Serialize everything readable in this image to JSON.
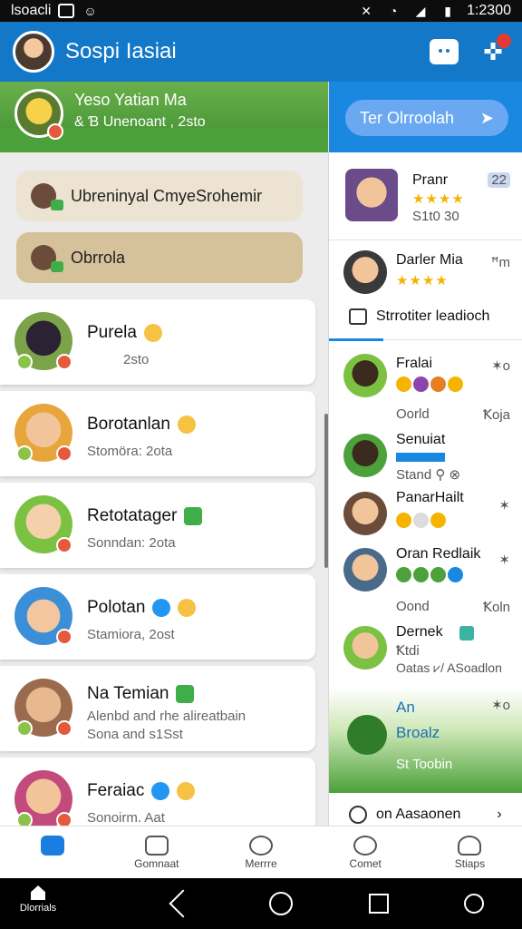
{
  "status_bar": {
    "left_text": "Ɩsoacli",
    "time": "1:2300"
  },
  "app_bar": {
    "title": "Sospi Iasiai"
  },
  "hero": {
    "title": "Yeso Yatian Ma",
    "subtitle": "& Ɓ Unenoant , 2sto"
  },
  "pills": [
    {
      "label": "Ubreninyal CmyeSrohemir"
    },
    {
      "label": "Obrrola"
    }
  ],
  "contacts": [
    {
      "name": "Purela",
      "meta": "2sto",
      "avatar_color": "#4b3a55"
    },
    {
      "name": "Borotanlan",
      "meta": "Stomöra: 2ota",
      "avatar_color": "#e6a63b"
    },
    {
      "name": "Retotatager",
      "meta": "Sonndan: 2ota",
      "avatar_color": "#7cc242"
    },
    {
      "name": "Polotan",
      "meta": "Stamiora, 2ost",
      "avatar_color": "#3b8fd6"
    },
    {
      "name": "Na Temian",
      "meta": "Alenbd and rhe alireatbain\nSona and s1Sst",
      "avatar_color": "#9a6b4e"
    },
    {
      "name": "Feraiac",
      "meta": "Sonoirm. Aat",
      "avatar_color": "#c24a7c"
    }
  ],
  "right_panel": {
    "cta_label": "Ter Olrroolah",
    "top_profiles": [
      {
        "name": "Pranr",
        "rank": "22",
        "stars": "★★★★",
        "sub": "S1t0 30"
      },
      {
        "name": "Darler Mia",
        "rank": "ꟸm",
        "stars": "★★★★",
        "sub": ""
      }
    ],
    "section_1": "Strrotiter leadioch",
    "friends": [
      {
        "name": "Fralai",
        "badge": "✶o",
        "sub": "Oorld",
        "right": "Ꝁoja"
      },
      {
        "name": "Senuiat",
        "badge": "",
        "sub": "Stand ⚲ ⊗",
        "right": ""
      },
      {
        "name": "PanarHailt",
        "badge": "✶",
        "sub": "",
        "right": ""
      },
      {
        "name": "Oran Redlaik",
        "badge": "✶",
        "sub": "Oond",
        "right": "Ꝁoln"
      },
      {
        "name": "Dernek",
        "badge": "",
        "sub": "Ꝁtdi",
        "right": ""
      }
    ],
    "friend_extra": "Oatas ⩗/ ASoadlon",
    "game_card": {
      "title": "An Broalz",
      "subtitle": "St Toobin",
      "badge": "✶o"
    },
    "section_2": "on Aasaonen"
  },
  "tabs": [
    {
      "label": ""
    },
    {
      "label": "Gomnaat"
    },
    {
      "label": "Merrre"
    },
    {
      "label": "Comet"
    },
    {
      "label": "Stiaps"
    }
  ],
  "nav": {
    "home_label": "Dlorrials"
  }
}
